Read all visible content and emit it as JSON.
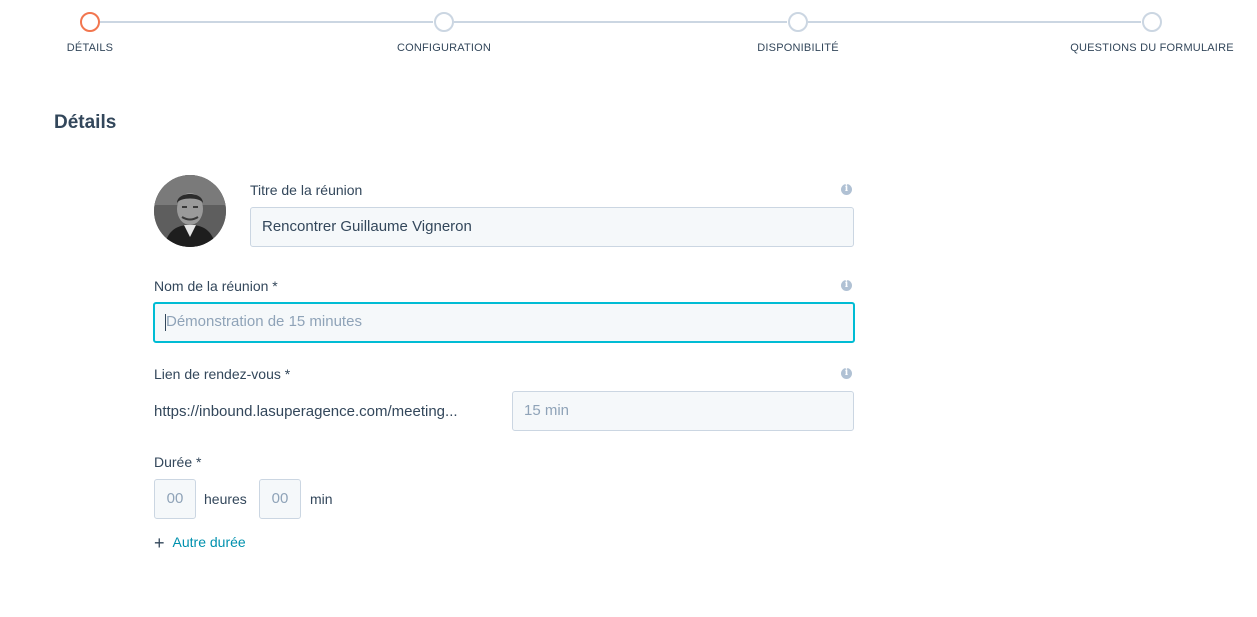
{
  "stepper": {
    "steps": [
      {
        "label": "DÉTAILS",
        "active": true
      },
      {
        "label": "CONFIGURATION",
        "active": false
      },
      {
        "label": "DISPONIBILITÉ",
        "active": false
      },
      {
        "label": "QUESTIONS DU FORMULAIRE",
        "active": false
      }
    ],
    "active_color": "#f2764f",
    "inactive_color": "#cbd6e2"
  },
  "section_title": "Détails",
  "form": {
    "meeting_title": {
      "label": "Titre de la réunion",
      "value": "Rencontrer Guillaume Vigneron",
      "icon": "info-icon"
    },
    "meeting_name": {
      "label": "Nom de la réunion *",
      "placeholder": "Démonstration de 15 minutes",
      "icon": "info-icon",
      "focus_color": "#00bcd4"
    },
    "meeting_link": {
      "label": "Lien de rendez-vous *",
      "url_prefix": "https://inbound.lasuperagence.com/meeting...",
      "placeholder": "15 min",
      "icon": "info-icon"
    },
    "duration": {
      "label": "Durée *",
      "hours_placeholder": "00",
      "hours_unit": "heures",
      "minutes_placeholder": "00",
      "minutes_unit": "min"
    },
    "other_duration": {
      "label": "Autre durée",
      "icon": "plus-icon",
      "color": "#0091ae"
    }
  }
}
